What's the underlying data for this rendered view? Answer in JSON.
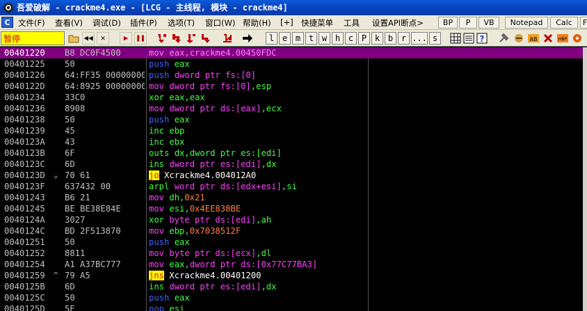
{
  "window": {
    "title": "吾爱破解 - crackme4.exe - [LCG -  主线程, 模块 - crackme4]"
  },
  "menu": {
    "icon_letter": "C",
    "items": [
      "文件(F)",
      "查看(V)",
      "调试(D)",
      "插件(P)",
      "选项(T)",
      "窗口(W)",
      "帮助(H)",
      "[+]",
      "快捷菜单",
      "工具",
      "设置API断点>"
    ],
    "buttons": [
      "BP",
      "P",
      "VB",
      "Notepad",
      "Calc",
      "F"
    ]
  },
  "toolbar": {
    "status": "暂停",
    "letters": [
      "l",
      "e",
      "m",
      "t",
      "w",
      "h",
      "c",
      "P",
      "k",
      "b",
      "r",
      "...",
      "s"
    ]
  },
  "disasm": [
    {
      "addr": "00401220",
      "mark": "",
      "hex": "B8 DC0F4500",
      "mn": "mov",
      "ops": [
        [
          "op",
          "eax,"
        ],
        [
          "op",
          "crackme4.00450FDC"
        ]
      ],
      "selected": true
    },
    {
      "addr": "00401225",
      "mark": "",
      "hex": "50",
      "mn": "push",
      "ops": [
        [
          "op-reg",
          "eax"
        ]
      ]
    },
    {
      "addr": "00401226",
      "mark": "",
      "hex": "64:FF35 00000000",
      "mn": "push",
      "ops": [
        [
          "op-mem",
          "dword ptr fs:[0]"
        ]
      ]
    },
    {
      "addr": "0040122D",
      "mark": "",
      "hex": "64:8925 00000000",
      "mn": "mov",
      "ops": [
        [
          "op-mem",
          "dword ptr fs:[0]"
        ],
        [
          "op-reg",
          ",esp"
        ]
      ]
    },
    {
      "addr": "00401234",
      "mark": "",
      "hex": "33C0",
      "mn": "xor",
      "ops": [
        [
          "op-reg",
          "eax,eax"
        ]
      ]
    },
    {
      "addr": "00401236",
      "mark": "",
      "hex": "8908",
      "mn": "mov",
      "ops": [
        [
          "op-mem",
          "dword ptr ds:[eax]"
        ],
        [
          "op-reg",
          ",ecx"
        ]
      ]
    },
    {
      "addr": "00401238",
      "mark": "",
      "hex": "50",
      "mn": "push",
      "ops": [
        [
          "op-reg",
          "eax"
        ]
      ]
    },
    {
      "addr": "00401239",
      "mark": "",
      "hex": "45",
      "mn": "inc",
      "ops": [
        [
          "op-reg",
          "ebp"
        ]
      ]
    },
    {
      "addr": "0040123A",
      "mark": "",
      "hex": "43",
      "mn": "inc",
      "ops": [
        [
          "op-reg",
          "ebx"
        ]
      ]
    },
    {
      "addr": "0040123B",
      "mark": "",
      "hex": "6F",
      "mn": "outs",
      "ops": [
        [
          "op-reg",
          "dx,dword ptr es:[edi]"
        ]
      ]
    },
    {
      "addr": "0040123C",
      "mark": "",
      "hex": "6D",
      "mn": "ins",
      "ops": [
        [
          "op-mem",
          "dword ptr es:[edi]"
        ],
        [
          "op-reg",
          ",dx"
        ]
      ]
    },
    {
      "addr": "0040123D",
      "mark": "⌄",
      "hex": "70 61",
      "mn": "jo",
      "ops": [
        [
          "op-w",
          "Xcrackme4.004012A0"
        ]
      ]
    },
    {
      "addr": "0040123F",
      "mark": "",
      "hex": "637432 00",
      "mn": "arpl",
      "ops": [
        [
          "op-mem",
          "word ptr ds:[edx+esi]"
        ],
        [
          "op-reg",
          ",si"
        ]
      ]
    },
    {
      "addr": "00401243",
      "mark": "",
      "hex": "B6 21",
      "mn": "mov",
      "ops": [
        [
          "op-reg",
          "dh,"
        ],
        [
          "op-num",
          "0x21"
        ]
      ]
    },
    {
      "addr": "00401245",
      "mark": "",
      "hex": "BE BE38E84E",
      "mn": "mov",
      "ops": [
        [
          "op-reg",
          "esi,"
        ],
        [
          "op-num",
          "0x4EE838BE"
        ]
      ]
    },
    {
      "addr": "0040124A",
      "mark": "",
      "hex": "3027",
      "mn": "xor",
      "ops": [
        [
          "op-mem",
          "byte ptr ds:[edi]"
        ],
        [
          "op-reg",
          ",ah"
        ]
      ]
    },
    {
      "addr": "0040124C",
      "mark": "",
      "hex": "BD 2F513870",
      "mn": "mov",
      "ops": [
        [
          "op-reg",
          "ebp,"
        ],
        [
          "op-num",
          "0x7038512F"
        ]
      ]
    },
    {
      "addr": "00401251",
      "mark": "",
      "hex": "50",
      "mn": "push",
      "ops": [
        [
          "op-reg",
          "eax"
        ]
      ]
    },
    {
      "addr": "00401252",
      "mark": "",
      "hex": "8811",
      "mn": "mov",
      "ops": [
        [
          "op-mem",
          "byte ptr ds:[ecx]"
        ],
        [
          "op-reg",
          ",dl"
        ]
      ]
    },
    {
      "addr": "00401254",
      "mark": "",
      "hex": "A1 A37BC777",
      "mn": "mov",
      "ops": [
        [
          "op-reg",
          "eax,"
        ],
        [
          "op-mem",
          "dword ptr ds:[0x77C77BA3]"
        ]
      ]
    },
    {
      "addr": "00401259",
      "mark": "^",
      "hex": "79 A5",
      "mn": "jns",
      "ops": [
        [
          "op-w",
          "Xcrackme4.00401200"
        ]
      ]
    },
    {
      "addr": "0040125B",
      "mark": "",
      "hex": "6D",
      "mn": "ins",
      "ops": [
        [
          "op-mem",
          "dword ptr es:[edi]"
        ],
        [
          "op-reg",
          ",dx"
        ]
      ]
    },
    {
      "addr": "0040125C",
      "mark": "",
      "hex": "50",
      "mn": "push",
      "ops": [
        [
          "op-reg",
          "eax"
        ]
      ]
    },
    {
      "addr": "0040125D",
      "mark": "",
      "hex": "5E",
      "mn": "pop",
      "ops": [
        [
          "op-reg",
          "esi"
        ]
      ]
    }
  ],
  "colors": {
    "selection": "#800080",
    "jump_highlight": "#ffff00",
    "mov": "#ff40ff",
    "push": "#4060ff",
    "arith": "#40ff40"
  }
}
